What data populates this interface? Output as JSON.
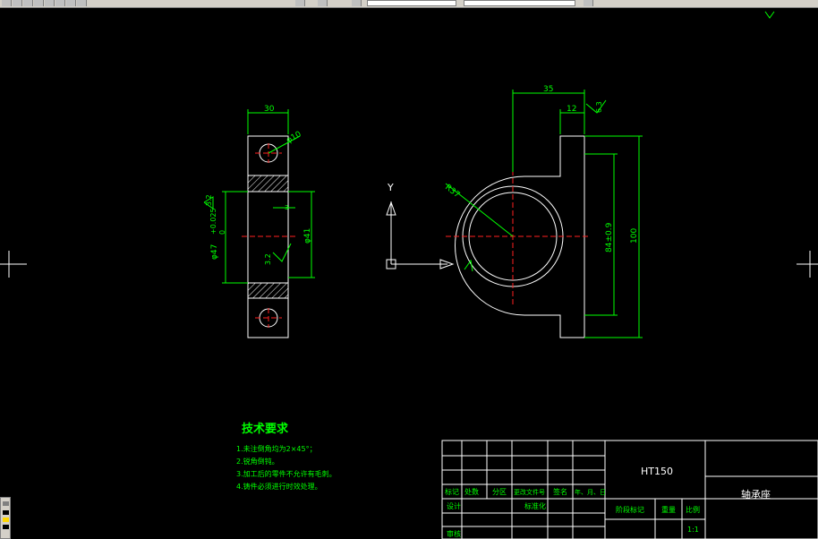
{
  "colors": {
    "background": "#000000",
    "geometry": "#ffffff",
    "dimension": "#00ff00",
    "centerline": "#ff2020",
    "tech_text": "#00ff00",
    "title_block": "#ffffff",
    "title_text": "#00ff00",
    "axis_icon": "#ffffff"
  },
  "left_view": {
    "dim_width": "30",
    "dim_hole": "φ10",
    "dim_bore": "φ47",
    "dim_bore_tol_upper": "+0.025",
    "dim_bore_tol_lower": "0",
    "dim_inner": "φ41",
    "dim_small_a": "3",
    "roughness_a": "3.2",
    "roughness_b": "3.2"
  },
  "right_view": {
    "dim_top": "35",
    "dim_top_small": "12",
    "roughness_top": "6.3",
    "dim_radius": "R37",
    "dim_height_inner": "84±0.9",
    "dim_height_total": "100"
  },
  "ucs": {
    "y_label": "Y"
  },
  "tech_requirements": {
    "title": "技术要求",
    "items": [
      "1.未注倒角均为2×45°；",
      "2.锐角倒钝。",
      "3.加工后的零件不允许有毛刺。",
      "4.铸件必须进行时效处理。"
    ]
  },
  "title_block": {
    "material": "HT150",
    "part_name": "轴承座",
    "headers": [
      "标记",
      "处数",
      "分区",
      "更改文件号",
      "签名",
      "年、月、日"
    ],
    "row_design": "设计",
    "row_standard": "标准化",
    "row_review": "审核",
    "stage_mark": "阶段标记",
    "weight": "重量",
    "scale_label": "比例",
    "scale_value": "1:1"
  }
}
